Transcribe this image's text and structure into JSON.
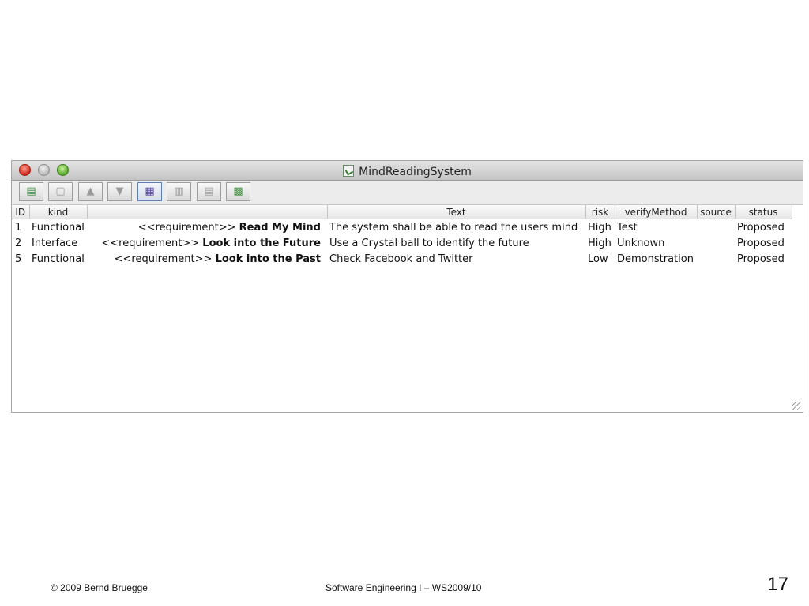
{
  "window": {
    "title": "MindReadingSystem"
  },
  "toolbar": {
    "buttons": [
      {
        "name": "add-requirement-button",
        "icon": "add-icon"
      },
      {
        "name": "delete-button",
        "icon": "trash-icon"
      },
      {
        "name": "move-up-button",
        "icon": "arrow-up-icon"
      },
      {
        "name": "move-down-button",
        "icon": "arrow-down-icon"
      },
      {
        "name": "table-view-button",
        "icon": "table-view-icon",
        "active": true
      },
      {
        "name": "column-view-button",
        "icon": "columns-icon"
      },
      {
        "name": "row-view-button",
        "icon": "rows-icon"
      },
      {
        "name": "tree-view-button",
        "icon": "tree-icon"
      }
    ]
  },
  "table": {
    "headers": [
      "ID",
      "kind",
      "",
      "Text",
      "risk",
      "verifyMethod",
      "source",
      "status"
    ],
    "rows": [
      {
        "id": "1",
        "kind": "Functional",
        "stereotype": "<<requirement>>",
        "name": "Read My Mind",
        "text": "The system shall be able to read the users mind",
        "risk": "High",
        "verify": "Test",
        "source": "",
        "status": "Proposed"
      },
      {
        "id": "2",
        "kind": "Interface",
        "stereotype": "<<requirement>>",
        "name": "Look into the Future",
        "text": "Use a Crystal ball to identify the future",
        "risk": "High",
        "verify": "Unknown",
        "source": "",
        "status": "Proposed"
      },
      {
        "id": "5",
        "kind": "Functional",
        "stereotype": "<<requirement>>",
        "name": "Look into the Past",
        "text": "Check Facebook and Twitter",
        "risk": "Low",
        "verify": "Demonstration",
        "source": "",
        "status": "Proposed"
      }
    ]
  },
  "footer": {
    "copyright": "© 2009 Bernd Bruegge",
    "course": "Software Engineering  I – WS2009/10",
    "page": "17"
  }
}
